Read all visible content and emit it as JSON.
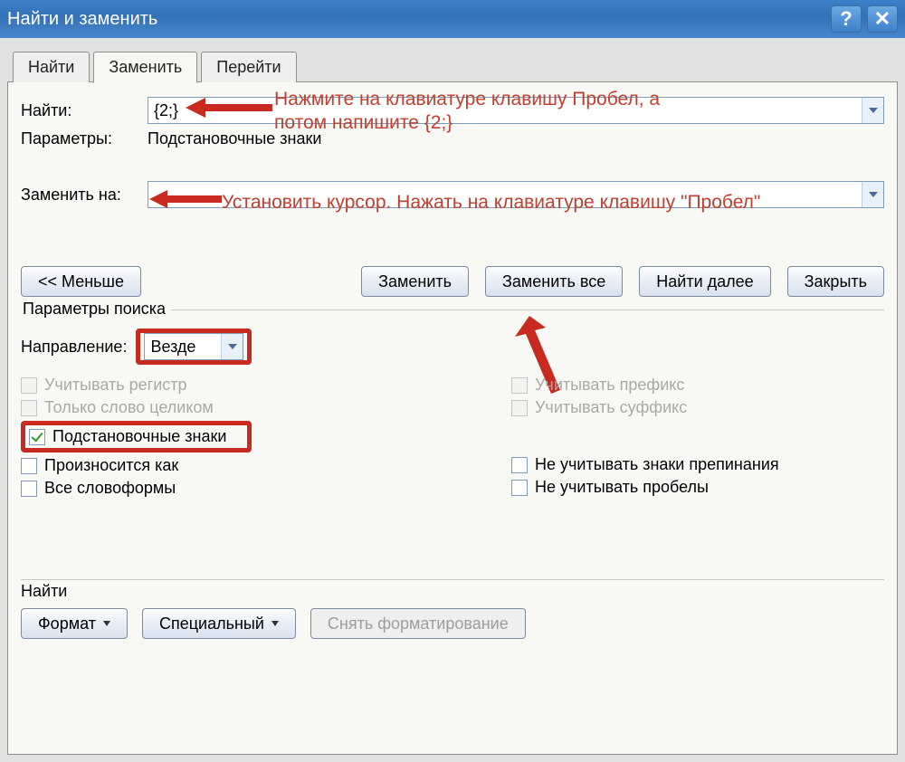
{
  "titlebar": {
    "title": "Найти и заменить",
    "help": "?",
    "close": "✕"
  },
  "tabs": {
    "find": "Найти",
    "replace": "Заменить",
    "goto": "Перейти"
  },
  "labels": {
    "find": "Найти:",
    "params": "Параметры:",
    "params_val": "Подстановочные знаки",
    "replace": "Заменить на:"
  },
  "fields": {
    "find_value": "{2;}"
  },
  "hints": {
    "find": "Нажмите на клавиатуре клавишу Пробел, а\nпотом напишите {2;}",
    "replace": "Установить курсор. Нажать на клавиатуре клавишу \"Пробел\""
  },
  "buttons": {
    "less": "<< Меньше",
    "replace": "Заменить",
    "replace_all": "Заменить все",
    "find_next": "Найти далее",
    "close": "Закрыть"
  },
  "search": {
    "legend": "Параметры поиска",
    "direction_lbl": "Направление:",
    "direction_val": "Везде",
    "match_case": "Учитывать регистр",
    "whole_word": "Только слово целиком",
    "wildcards": "Подстановочные знаки",
    "sounds": "Произносится как",
    "forms": "Все словоформы",
    "prefix": "Учитывать префикс",
    "suffix": "Учитывать суффикс",
    "punct": "Не учитывать знаки препинания",
    "ws": "Не учитывать пробелы"
  },
  "footer": {
    "find": "Найти",
    "format": "Формат",
    "special": "Специальный",
    "clear": "Снять форматирование"
  }
}
